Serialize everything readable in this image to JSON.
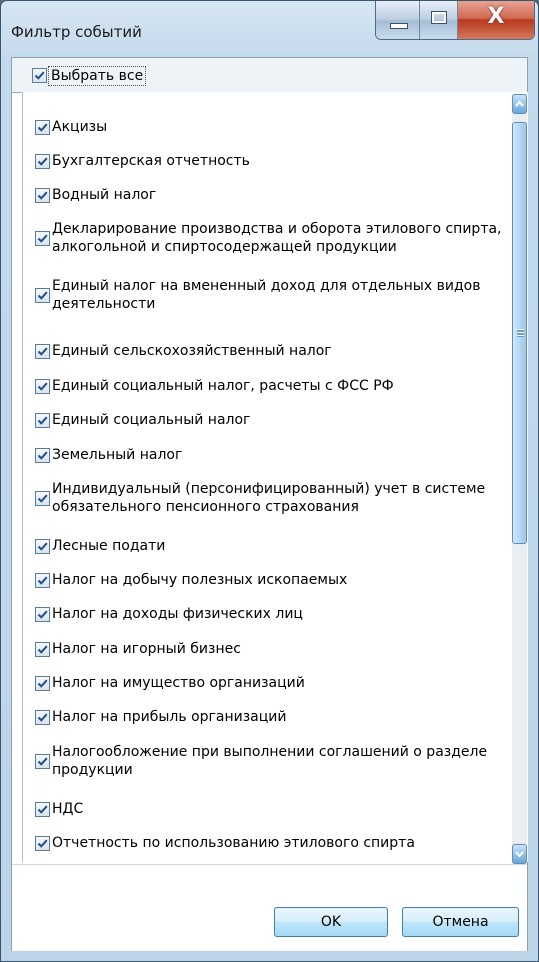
{
  "window": {
    "title": "Фильтр событий"
  },
  "select_all": {
    "label": "Выбрать все",
    "checked": true
  },
  "items": [
    {
      "label": "Акцизы",
      "checked": true
    },
    {
      "label": "Бухгалтерская отчетность",
      "checked": true
    },
    {
      "label": "Водный налог",
      "checked": true
    },
    {
      "label": "Декларирование производства и оборота этилового спирта, алкогольной и спиртосодержащей продукции",
      "checked": true
    },
    {
      "label": "Единый налог на вмененный доход для отдельных видов деятельности",
      "checked": true
    },
    {
      "label": "Единый сельскохозяйственный налог",
      "checked": true
    },
    {
      "label": "Единый социальный налог, расчеты с ФСС РФ",
      "checked": true
    },
    {
      "label": "Единый социальный налог",
      "checked": true
    },
    {
      "label": "Земельный налог",
      "checked": true
    },
    {
      "label": "Индивидуальный (персонифицированный) учет в системе обязательного пенсионного страхования",
      "checked": true
    },
    {
      "label": "Лесные подати",
      "checked": true
    },
    {
      "label": "Налог на добычу полезных ископаемых",
      "checked": true
    },
    {
      "label": "Налог на доходы физических лиц",
      "checked": true
    },
    {
      "label": "Налог на игорный бизнес",
      "checked": true
    },
    {
      "label": "Налог на имущество организаций",
      "checked": true
    },
    {
      "label": "Налог на прибыль организаций",
      "checked": true
    },
    {
      "label": "Налогообложение при выполнении соглашений о разделе продукции",
      "checked": true
    },
    {
      "label": "НДС",
      "checked": true
    },
    {
      "label": "Отчетность по использованию этилового спирта",
      "checked": true
    }
  ],
  "buttons": {
    "ok": "OK",
    "cancel": "Отмена"
  },
  "icons": {
    "checkmark": "check-icon",
    "minimize": "minimize-icon",
    "maximize": "maximize-icon",
    "close": "close-icon",
    "scroll_up": "chevron-up-icon",
    "scroll_down": "chevron-down-icon"
  },
  "colors": {
    "accent": "#2b6cb0",
    "close": "#c24125"
  }
}
